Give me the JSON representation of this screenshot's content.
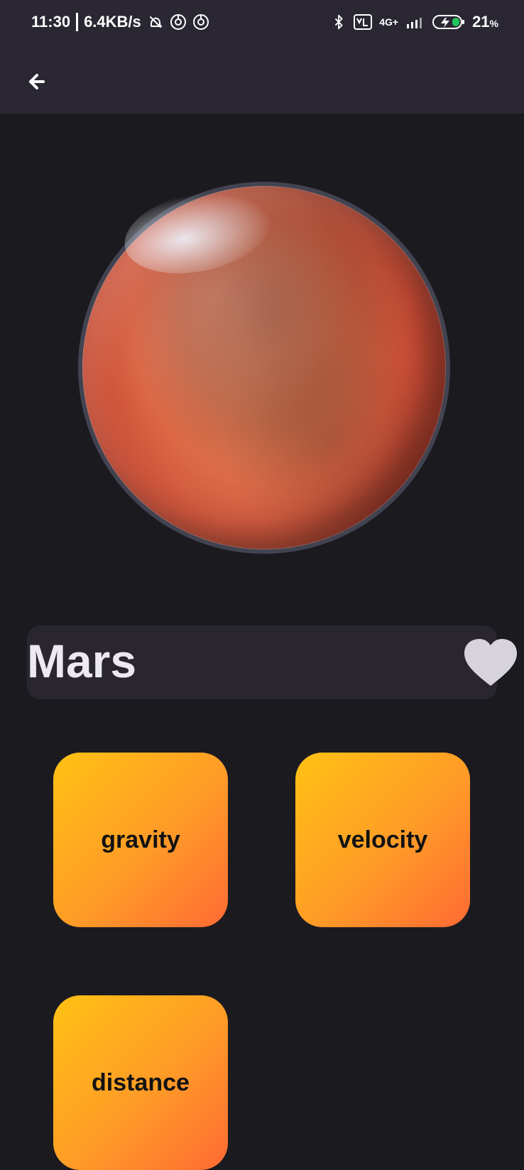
{
  "status_bar": {
    "time": "11:30",
    "net_speed": "6.4KB/s",
    "network_small": "4G+",
    "battery": "21",
    "battery_unit": "%"
  },
  "planet": {
    "name": "Mars"
  },
  "tiles": [
    {
      "label": "gravity"
    },
    {
      "label": "velocity"
    },
    {
      "label": "distance"
    }
  ],
  "icons": {
    "back": "back-arrow-icon",
    "favorite": "heart-icon",
    "bluetooth": "bluetooth-icon",
    "lte": "volte-icon",
    "signal": "signal-icon",
    "battery": "battery-icon",
    "mute": "bell-off-icon",
    "do_not_disturb": "disturb-icon"
  },
  "colors": {
    "background": "#1b1a1f",
    "bar": "#2a2733",
    "tile_start": "#ffc114",
    "tile_end": "#ff6a34",
    "heart": "#d7d3dc",
    "title": "#ece9f3"
  }
}
